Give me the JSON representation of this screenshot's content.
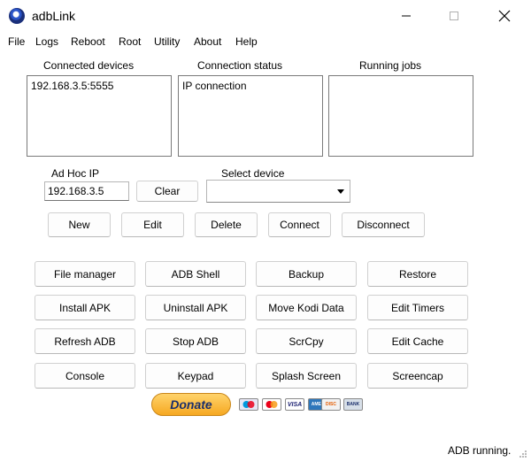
{
  "window": {
    "title": "adbLink"
  },
  "menu": [
    "File",
    "Logs",
    "Reboot",
    "Root",
    "Utility",
    "About",
    "Help"
  ],
  "panels": {
    "connected_devices": {
      "label": "Connected devices",
      "items": [
        "192.168.3.5:5555"
      ]
    },
    "connection_status": {
      "label": "Connection status",
      "items": [
        "IP connection"
      ]
    },
    "running_jobs": {
      "label": "Running jobs",
      "items": []
    }
  },
  "adhoc": {
    "label": "Ad Hoc IP",
    "value": "192.168.3.5",
    "clear_label": "Clear"
  },
  "select_device": {
    "label": "Select device",
    "value": ""
  },
  "device_buttons": {
    "new": "New",
    "edit": "Edit",
    "delete": "Delete",
    "connect": "Connect",
    "disconnect": "Disconnect"
  },
  "tools": {
    "row1": [
      "File manager",
      "ADB Shell",
      "Backup",
      "Restore"
    ],
    "row2": [
      "Install APK",
      "Uninstall APK",
      "Move Kodi Data",
      "Edit Timers"
    ],
    "row3": [
      "Refresh ADB",
      "Stop ADB",
      "ScrCpy",
      "Edit Cache"
    ],
    "row4": [
      "Console",
      "Keypad",
      "Splash Screen",
      "Screencap"
    ]
  },
  "donate": {
    "label": "Donate",
    "cards": [
      "Maestro",
      "MasterCard",
      "VISA",
      "AMEX",
      "DISCOVER",
      "BANK"
    ]
  },
  "status": {
    "text": "ADB running."
  },
  "colors": {
    "donate_gold": "#f6a821",
    "donate_text": "#1b2f6b",
    "visa_blue": "#1a1f71",
    "mastercard_red": "#eb001b"
  },
  "icons": {
    "app": "adblink-icon",
    "minimize": "minimize-icon",
    "maximize": "maximize-icon",
    "close": "close-icon",
    "dropdown": "chevron-down-icon"
  }
}
